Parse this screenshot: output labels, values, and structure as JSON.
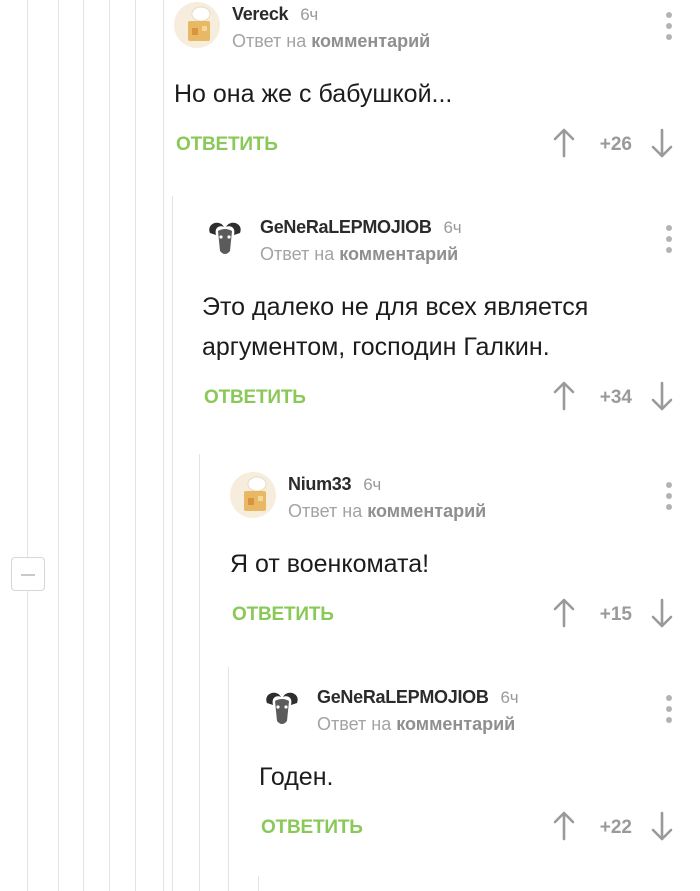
{
  "comments": [
    {
      "author": "Vereck",
      "time": "6ч",
      "reply_prefix": "Ответ на",
      "reply_link": "комментарий",
      "text": "Но она же с бабушкой...",
      "reply_label": "ОТВЕТИТЬ",
      "score": "+26",
      "avatar": "chef-house-avatar"
    },
    {
      "author": "GeNeRaLEPMOJIOB",
      "time": "6ч",
      "reply_prefix": "Ответ на",
      "reply_link": "комментарий",
      "text": "Это  далеко не для всех является аргументом, господин Галкин.",
      "reply_label": "ОТВЕТИТЬ",
      "score": "+34",
      "avatar": "ram-head-avatar"
    },
    {
      "author": "Nium33",
      "time": "6ч",
      "reply_prefix": "Ответ на",
      "reply_link": "комментарий",
      "text": "Я от военкомата!",
      "reply_label": "ОТВЕТИТЬ",
      "score": "+15",
      "avatar": "chef-house-avatar"
    },
    {
      "author": "GeNeRaLEPMOJIOB",
      "time": "6ч",
      "reply_prefix": "Ответ на",
      "reply_link": "комментарий",
      "text": "Годен.",
      "reply_label": "ОТВЕТИТЬ",
      "score": "+22",
      "avatar": "ram-head-avatar"
    }
  ],
  "icons": {
    "more": "more-vertical-icon",
    "upvote": "arrow-up-icon",
    "downvote": "arrow-down-icon",
    "collapse": "collapse-minus-icon"
  },
  "colors": {
    "reply_green": "#8ac858",
    "muted_gray": "#9a9a9a",
    "thread_line": "#e4e4e4"
  }
}
